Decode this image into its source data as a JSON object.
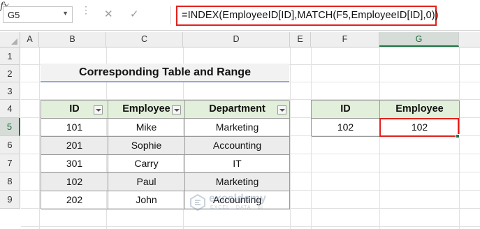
{
  "formula_bar": {
    "name_box": "G5",
    "formula": "=INDEX(EmployeeID[ID],MATCH(F5,EmployeeID[ID],0))",
    "cancel_icon": "✕",
    "enter_icon": "✓",
    "fx_label": "fx"
  },
  "columns": [
    "A",
    "B",
    "C",
    "D",
    "E",
    "F",
    "G"
  ],
  "rows": [
    "1",
    "2",
    "3",
    "4",
    "5",
    "6",
    "7",
    "8",
    "9"
  ],
  "selected": {
    "column": "G",
    "row": "5"
  },
  "title": "Corresponding Table and Range",
  "left_table": {
    "headers": [
      "ID",
      "Employee",
      "Department"
    ],
    "rows": [
      [
        "101",
        "Mike",
        "Marketing"
      ],
      [
        "201",
        "Sophie",
        "Accounting"
      ],
      [
        "301",
        "Carry",
        "IT"
      ],
      [
        "102",
        "Paul",
        "Marketing"
      ],
      [
        "202",
        "John",
        "Accounting"
      ]
    ]
  },
  "right_table": {
    "headers": [
      "ID",
      "Employee"
    ],
    "rows": [
      [
        "102",
        "102"
      ]
    ]
  },
  "watermark": {
    "name": "exceldemy",
    "sub": "EXCEL · DATA · BI"
  },
  "colors": {
    "header_fill": "#e2efda",
    "row_shade": "#ececec",
    "highlight_border": "#e2211c",
    "title_underline": "#8ea9db",
    "excel_green": "#217346"
  }
}
